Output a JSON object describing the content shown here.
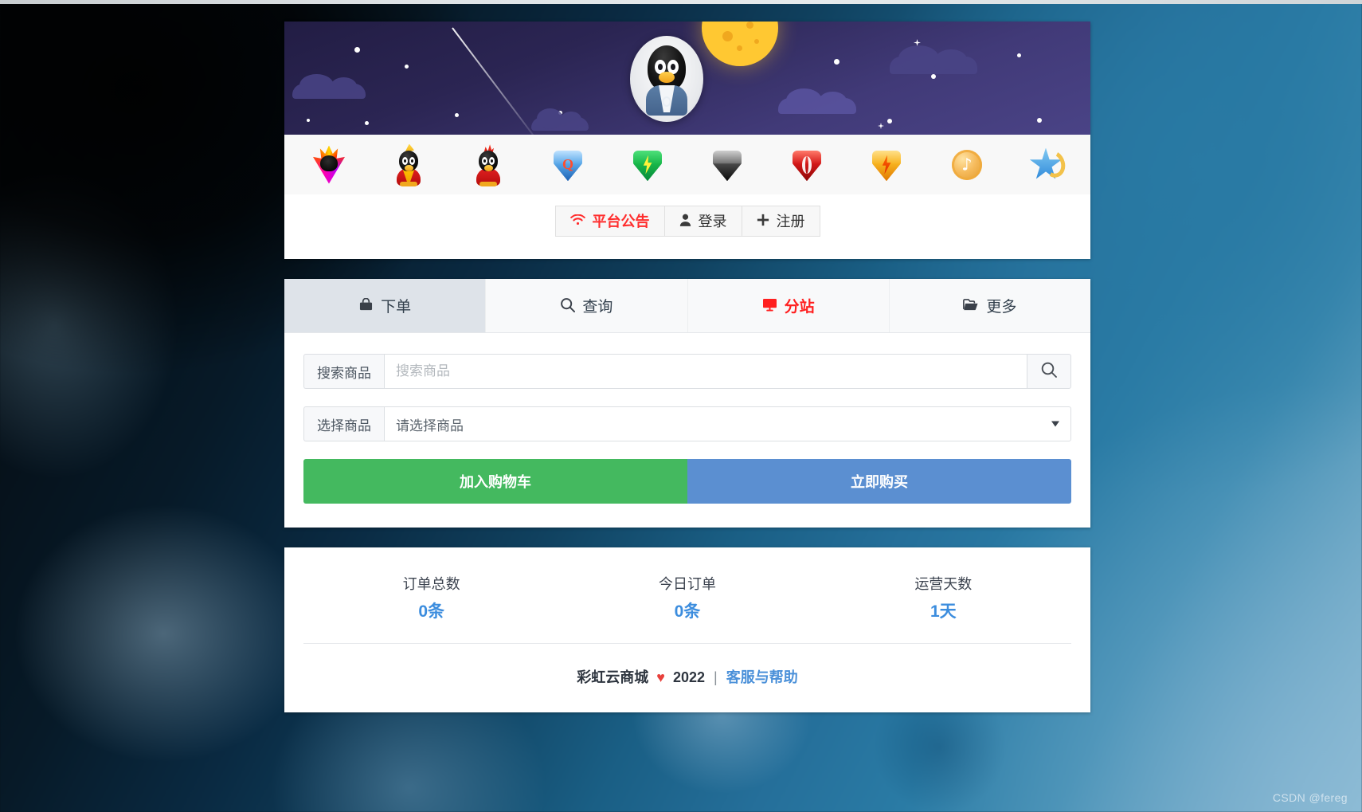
{
  "banner": {
    "avatar_alt": "qq-penguin-avatar"
  },
  "icon_strip": {
    "icons": [
      {
        "name": "qq-flame-icon"
      },
      {
        "name": "qq-penguin-yellow-crest-icon"
      },
      {
        "name": "qq-penguin-red-crest-icon"
      },
      {
        "name": "gem-blue-superq-icon",
        "mark": "Q"
      },
      {
        "name": "gem-green-bolt-icon"
      },
      {
        "name": "gem-black-icon"
      },
      {
        "name": "gem-red-swirl-icon"
      },
      {
        "name": "gem-orange-bolt-icon"
      },
      {
        "name": "coin-music-icon",
        "mark": "♪"
      },
      {
        "name": "star-moon-icon"
      }
    ]
  },
  "header_actions": {
    "announcement_label": "平台公告",
    "announcement_icon": "wifi-icon",
    "login_label": "登录",
    "login_icon": "user-icon",
    "register_label": "注册",
    "register_icon": "plus-icon"
  },
  "tabs": [
    {
      "label": "下单",
      "icon": "bag-icon",
      "active": true,
      "highlight": false
    },
    {
      "label": "查询",
      "icon": "search-icon",
      "active": false,
      "highlight": false
    },
    {
      "label": "分站",
      "icon": "monitor-icon",
      "active": false,
      "highlight": true
    },
    {
      "label": "更多",
      "icon": "folder-icon",
      "active": false,
      "highlight": false
    }
  ],
  "form": {
    "search_addon_label": "搜索商品",
    "search_placeholder": "搜索商品",
    "search_value": "",
    "search_button_icon": "search-icon",
    "select_addon_label": "选择商品",
    "select_value": "请选择商品",
    "add_to_cart_label": "加入购物车",
    "buy_now_label": "立即购买"
  },
  "stats": [
    {
      "label": "订单总数",
      "value": "0条"
    },
    {
      "label": "今日订单",
      "value": "0条"
    },
    {
      "label": "运营天数",
      "value": "1天"
    }
  ],
  "footer": {
    "site_name": "彩虹云商城",
    "heart": "♥",
    "year": "2022",
    "separator": "|",
    "help_link": "客服与帮助"
  },
  "watermark": "CSDN @fereg",
  "colors": {
    "accent_red": "#ff1f1f",
    "accent_blue": "#3c8dde",
    "btn_green": "#44b95f",
    "btn_blue": "#5b8fd1",
    "link_blue": "#4a90d9",
    "banner_purple": "#2b2553"
  }
}
